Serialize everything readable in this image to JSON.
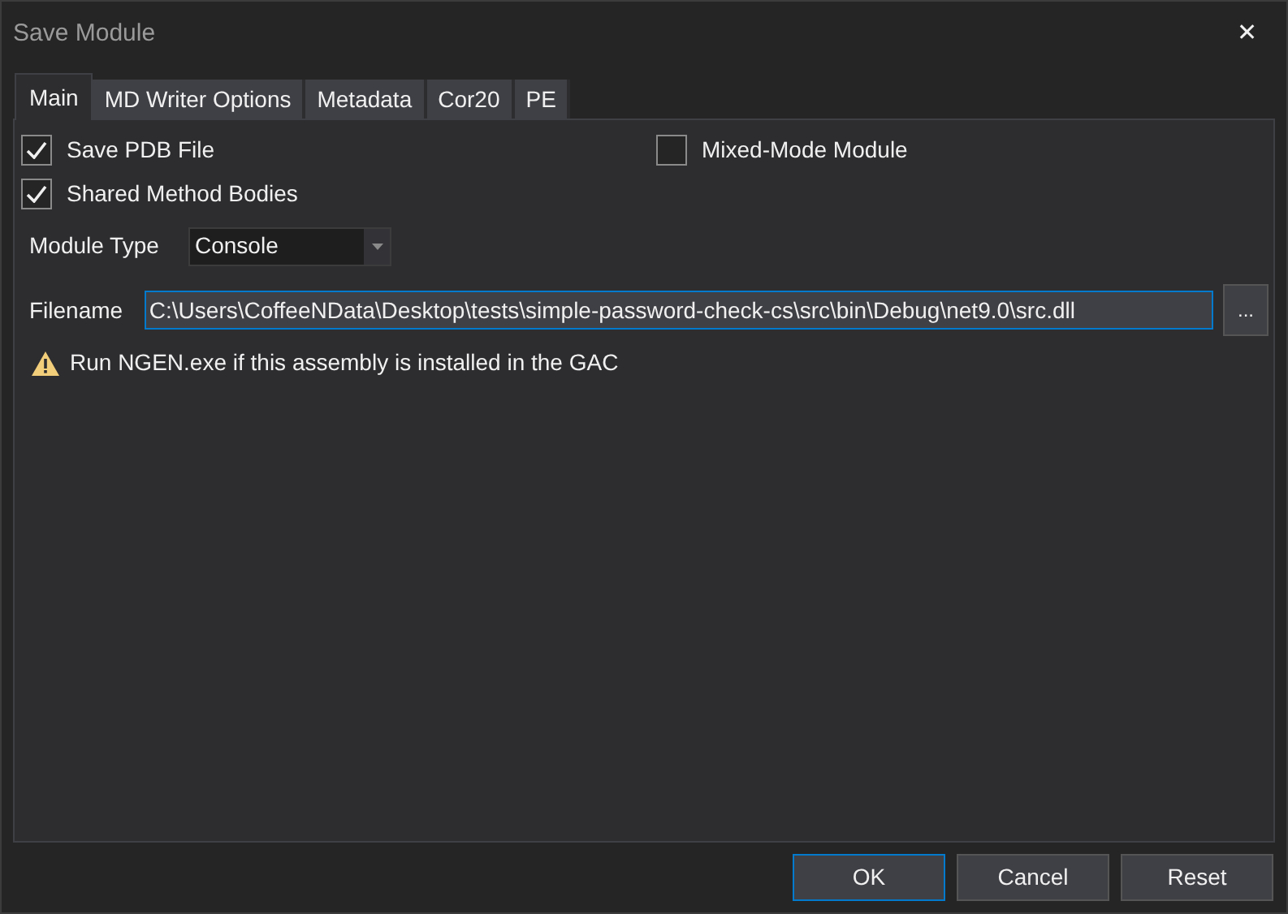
{
  "window": {
    "title": "Save Module",
    "close": "✕"
  },
  "tabs": [
    {
      "label": "Main",
      "selected": true
    },
    {
      "label": "MD Writer Options",
      "selected": false
    },
    {
      "label": "Metadata",
      "selected": false
    },
    {
      "label": "Cor20",
      "selected": false
    },
    {
      "label": "PE",
      "selected": false
    }
  ],
  "options": [
    {
      "label": "Save PDB File",
      "checked": true
    },
    {
      "label": "Mixed-Mode Module",
      "checked": false
    },
    {
      "label": "Shared Method Bodies",
      "checked": true
    }
  ],
  "module_type": {
    "label": "Module Type",
    "value": "Console"
  },
  "filename": {
    "label": "Filename",
    "value": "C:\\Users\\CoffeeNData\\Desktop\\tests\\simple-password-check-cs\\src\\bin\\Debug\\net9.0\\src.dll",
    "browse": "..."
  },
  "warning": "Run NGEN.exe if this assembly is installed in the GAC",
  "buttons": [
    {
      "label": "OK",
      "default": true
    },
    {
      "label": "Cancel",
      "default": false
    },
    {
      "label": "Reset",
      "default": false
    }
  ]
}
